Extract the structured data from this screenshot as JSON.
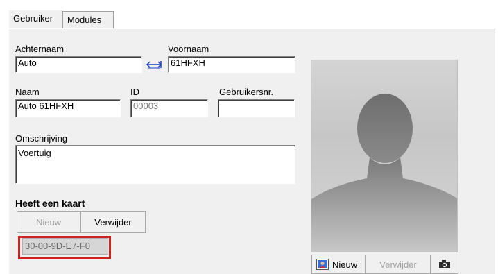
{
  "tabs": [
    {
      "label": "Gebruiker"
    },
    {
      "label": "Modules"
    }
  ],
  "form": {
    "achternaam_label": "Achternaam",
    "achternaam_value": "Auto",
    "voornaam_label": "Voornaam",
    "voornaam_value": "61HFXH",
    "naam_label": "Naam",
    "naam_value": "Auto 61HFXH",
    "id_label": "ID",
    "id_value": "00003",
    "gebruikersnr_label": "Gebruikersnr.",
    "gebruikersnr_value": "",
    "omschrijving_label": "Omschrijving",
    "omschrijving_value": "Voertuig"
  },
  "card": {
    "heading": "Heeft een kaart",
    "new_label": "Nieuw",
    "remove_label": "Verwijder",
    "card_id": "30-00-9D-E7-F0",
    "highlight_color": "#d02020"
  },
  "photo": {
    "new_label": "Nieuw",
    "remove_label": "Verwijder"
  },
  "icons": [
    "swap-arrow-icon",
    "photo-card-icon",
    "camera-icon"
  ],
  "colors": {
    "link_blue": "#1a3fc0",
    "panel": "#f0f0f0"
  }
}
